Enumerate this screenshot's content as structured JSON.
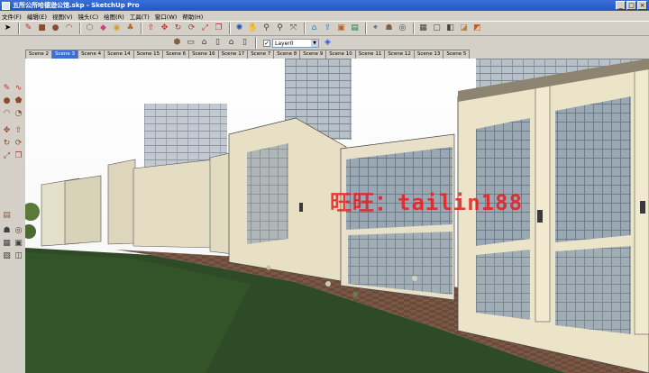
{
  "window": {
    "title": "五所公所哈德逊公馆.skp - SketchUp Pro"
  },
  "menu": {
    "items": [
      "文件(F)",
      "编辑(E)",
      "视图(V)",
      "镜头(C)",
      "绘图(R)",
      "工具(T)",
      "窗口(W)",
      "帮助(H)"
    ]
  },
  "toolbar": {
    "layer_value": "Layer0",
    "layer_check": "✓"
  },
  "scenes": {
    "tabs": [
      "Scene 2",
      "Scene 3",
      "Scene 4",
      "Scene 14",
      "Scene 15",
      "Scene 6",
      "Scene 16",
      "Scene 17",
      "Scene 7",
      "Scene 8",
      "Scene 9",
      "Scene 10",
      "Scene 11",
      "Scene 12",
      "Scene 13",
      "Scene 5"
    ],
    "active_index": 1
  },
  "viewport": {
    "watermark": "旺旺：tailin188"
  },
  "colors": {
    "title_bar": "#2456c4",
    "chrome": "#d4d0c8",
    "active_tab": "#3c6ed8",
    "watermark": "#e61e1e",
    "lawn": "#2e4a26",
    "paving": "#6b4a3a"
  }
}
